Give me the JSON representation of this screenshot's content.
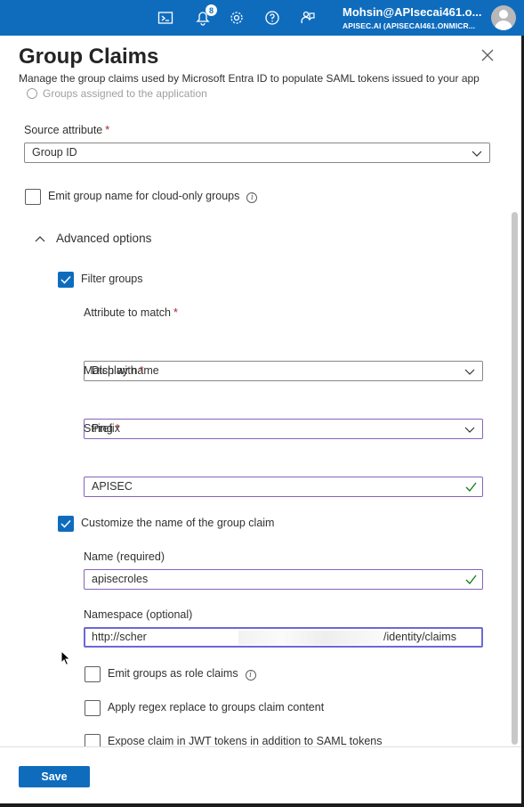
{
  "topbar": {
    "icons": [
      "cloud-shell-icon",
      "notifications-icon",
      "settings-icon",
      "help-icon",
      "feedback-icon"
    ],
    "notification_count": "8",
    "account_email": "Mohsin@APIsecai461.o...",
    "account_tenant": "APISEC.AI (APISECAI461.ONMICR..."
  },
  "panel": {
    "title": "Group Claims",
    "subtitle": "Manage the group claims used by Microsoft Entra ID to populate SAML tokens issued to your app",
    "faded_option": "Groups assigned to the application"
  },
  "form": {
    "source_attribute_label": "Source attribute",
    "source_attribute_value": "Group ID",
    "emit_cloud_only_label": "Emit group name for cloud-only groups",
    "emit_cloud_only_checked": false,
    "advanced_options_label": "Advanced options",
    "filter_groups_label": "Filter groups",
    "filter_groups_checked": true,
    "attribute_to_match_label": "Attribute to match",
    "attribute_to_match_value": "Display name",
    "match_with_label": "Match with",
    "match_with_value": "Prefix",
    "string_label": "String",
    "string_value": "APISEC",
    "customize_name_label": "Customize the name of the group claim",
    "customize_name_checked": true,
    "name_label": "Name (required)",
    "name_value": "apisecroles",
    "namespace_label": "Namespace (optional)",
    "namespace_value_start": "http://scher",
    "namespace_value_end": "/identity/claims",
    "emit_role_claims_label": "Emit groups as role claims",
    "apply_regex_label": "Apply regex replace to groups claim content",
    "expose_jwt_label": "Expose claim in JWT tokens in addition to SAML tokens",
    "required_marker": "*"
  },
  "footer": {
    "save_label": "Save"
  },
  "colors": {
    "brand_blue": "#0f6cbd",
    "required_red": "#a4262c",
    "valid_green": "#107c10"
  }
}
